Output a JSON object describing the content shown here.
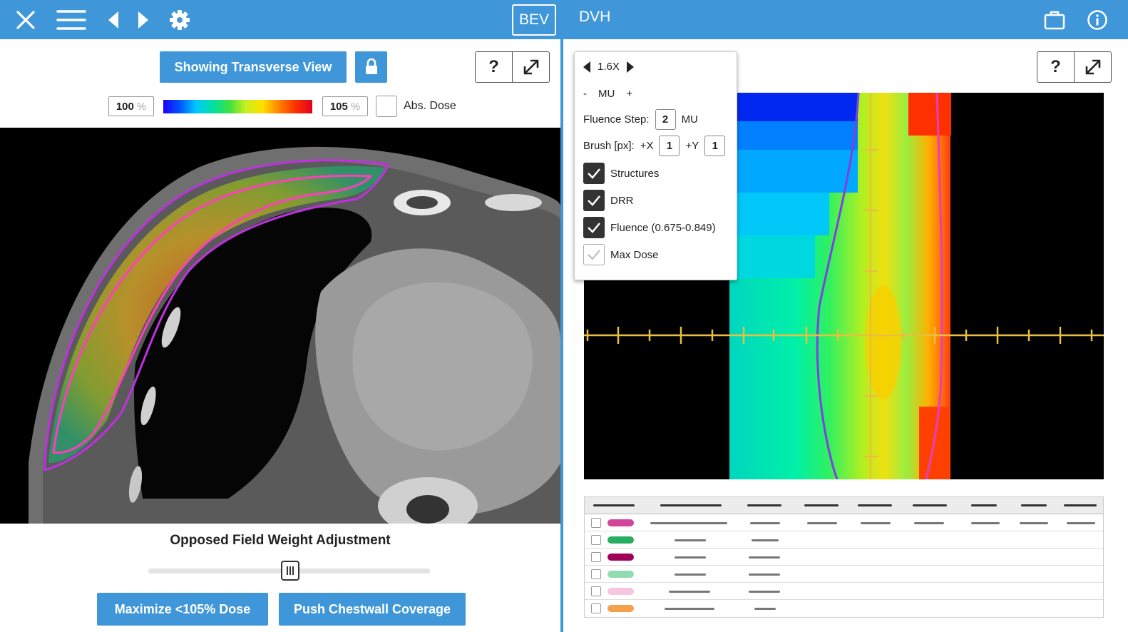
{
  "topbar": {
    "icons": [
      "close-icon",
      "menu-icon",
      "arrow-left-icon",
      "arrow-right-icon",
      "gear-icon",
      "briefcase-icon",
      "info-icon"
    ],
    "bev_label": "BEV",
    "dvh_label": "DVH",
    "bg_color": "#3f97d9"
  },
  "left": {
    "view_button": "Showing Transverse View",
    "help_label": "?",
    "dose_min": "100",
    "dose_max": "105",
    "pct_unit": "%",
    "abs_dose_label": "Abs. Dose",
    "slider_title": "Opposed Field Weight Adjustment",
    "slider_value": 0.5,
    "btn_maximize": "Maximize <105% Dose",
    "btn_push": "Push Chestwall Coverage"
  },
  "right": {
    "help_label": "?",
    "zoom": "1.6X",
    "mu_minus": "-",
    "mu_label": "MU",
    "mu_plus": "+",
    "fluence_step_label": "Fluence Step:",
    "fluence_step_value": "2",
    "fluence_step_unit": "MU",
    "brush_label": "Brush [px]:",
    "brush_x_label": "+X",
    "brush_x_value": "1",
    "brush_y_label": "+Y",
    "brush_y_value": "1",
    "toggles": [
      {
        "label": "Structures",
        "checked": true
      },
      {
        "label": "DRR",
        "checked": true
      },
      {
        "label": "Fluence (0.675-0.849)",
        "checked": true
      },
      {
        "label": "Max Dose",
        "checked": false
      }
    ],
    "dvh_rows": [
      {
        "color": "#d4449a"
      },
      {
        "color": "#27ae60"
      },
      {
        "color": "#a0005a"
      },
      {
        "color": "#90dcb0"
      },
      {
        "color": "#f5c6e0"
      },
      {
        "color": "#f5a04a"
      }
    ]
  }
}
